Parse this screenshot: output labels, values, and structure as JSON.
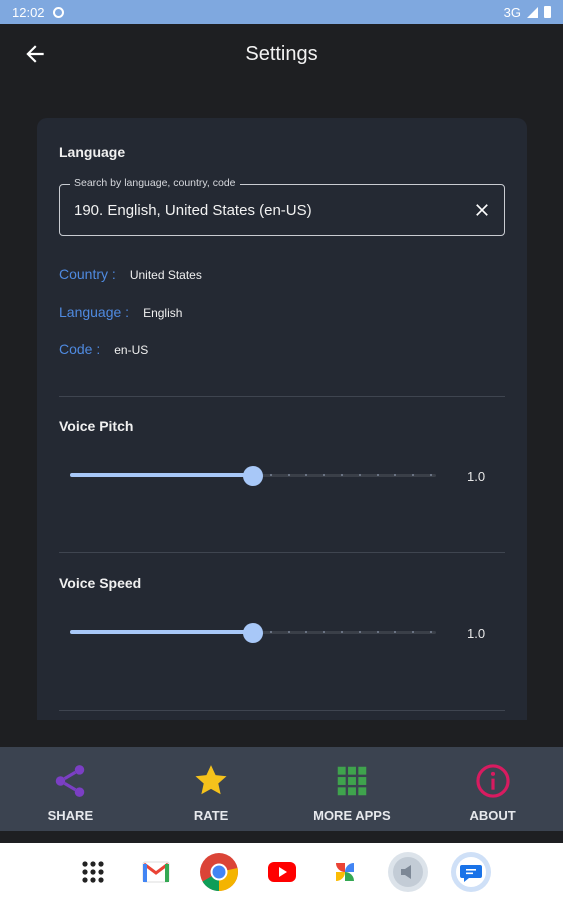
{
  "status_bar": {
    "time": "12:02",
    "network": "3G"
  },
  "app_bar": {
    "title": "Settings"
  },
  "language_section": {
    "title": "Language",
    "search": {
      "label": "Search by language, country, code",
      "value": "190. English, United States (en-US)"
    },
    "country": {
      "key": "Country :",
      "value": "United States"
    },
    "language": {
      "key": "Language :",
      "value": "English"
    },
    "code": {
      "key": "Code :",
      "value": "en-US"
    }
  },
  "voice_pitch": {
    "title": "Voice Pitch",
    "value_label": "1.0",
    "level": 0.5
  },
  "voice_speed": {
    "title": "Voice Speed",
    "value_label": "1.0",
    "level": 0.5
  },
  "bottom_nav": [
    {
      "label": "SHARE",
      "icon": "share-icon",
      "color": "#7b3fc4"
    },
    {
      "label": "RATE",
      "icon": "star-icon",
      "color": "#f5c21b"
    },
    {
      "label": "MORE APPS",
      "icon": "grid-icon",
      "color": "#3fa34d"
    },
    {
      "label": "ABOUT",
      "icon": "info-icon",
      "color": "#d81b60"
    }
  ],
  "taskbar": [
    "app-drawer-icon",
    "gmail-icon",
    "chrome-icon",
    "youtube-icon",
    "photos-icon",
    "speaker-app-icon",
    "messages-icon"
  ],
  "colors": {
    "status_bar": "#7fa8df",
    "accent": "#a8c8f8",
    "link": "#4f8ae0",
    "card": "#242933",
    "nav": "#3b4350"
  }
}
